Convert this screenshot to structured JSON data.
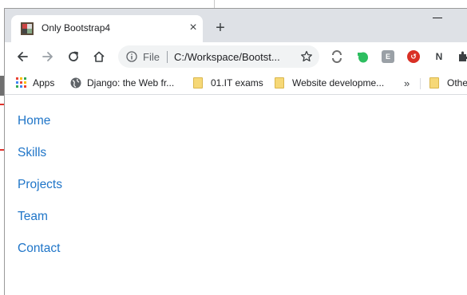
{
  "tab": {
    "title": "Only Bootstrap4",
    "favicon": "bootstrap-favicon-icon"
  },
  "toolbar": {
    "url_scheme_label": "File",
    "url": "C:/Workspace/Bootst..."
  },
  "bookmarks": {
    "apps_label": "Apps",
    "items": [
      {
        "label": "Django: the Web fr...",
        "icon": "globe-icon"
      },
      {
        "label": "01.IT exams",
        "icon": "folder-icon"
      },
      {
        "label": "Website developme...",
        "icon": "folder-icon"
      },
      {
        "label": "Othe",
        "icon": "folder-icon"
      }
    ],
    "more": "»"
  },
  "nav": {
    "items": [
      "Home",
      "Skills",
      "Projects",
      "Team",
      "Contact"
    ]
  },
  "colors": {
    "link": "#1f75c8",
    "titlebar": "#dee1e6"
  }
}
